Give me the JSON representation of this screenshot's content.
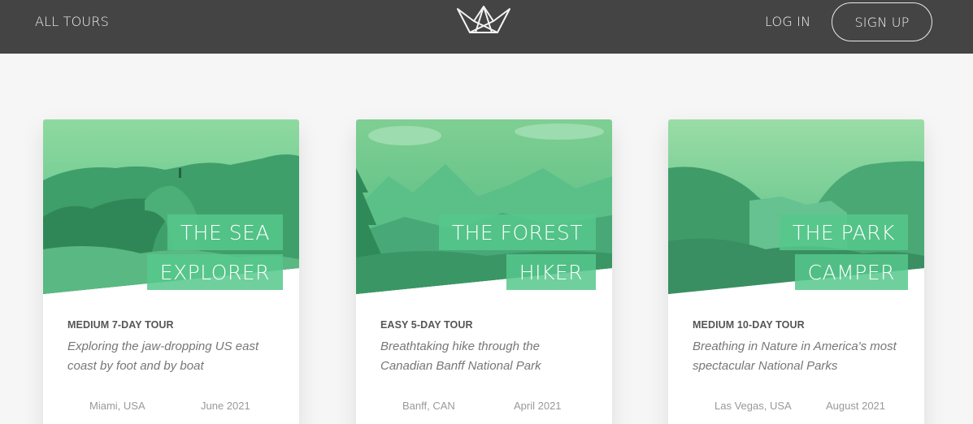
{
  "header": {
    "all_tours": "ALL TOURS",
    "login": "LOG IN",
    "signup": "SIGN UP"
  },
  "accent_color": "#55c57a",
  "cards": [
    {
      "title_line1": "THE SEA",
      "title_line2": "EXPLORER",
      "subheading": "MEDIUM 7-DAY TOUR",
      "description": "Exploring the jaw-dropping US east coast by foot and by boat",
      "location": "Miami, USA",
      "date": "June 2021"
    },
    {
      "title_line1": "THE FOREST",
      "title_line2": "HIKER",
      "subheading": "EASY 5-DAY TOUR",
      "description": "Breathtaking hike through the Canadian Banff National Park",
      "location": "Banff, CAN",
      "date": "April 2021"
    },
    {
      "title_line1": "THE PARK",
      "title_line2": "CAMPER",
      "subheading": "MEDIUM 10-DAY TOUR",
      "description": "Breathing in Nature in America's most spectacular National Parks",
      "location": "Las Vegas, USA",
      "date": "August 2021"
    }
  ]
}
